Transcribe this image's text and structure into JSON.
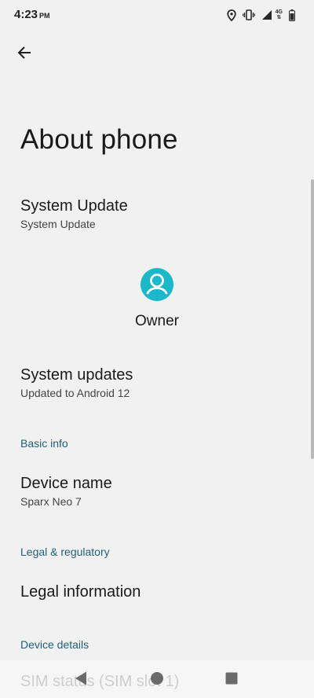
{
  "status_bar": {
    "time": "4:23",
    "ampm": "PM",
    "network_label": "4G"
  },
  "header": {
    "title": "About phone"
  },
  "items": {
    "system_update": {
      "title": "System Update",
      "subtitle": "System Update"
    },
    "owner": {
      "name": "Owner"
    },
    "system_updates": {
      "title": "System updates",
      "subtitle": "Updated to Android 12"
    },
    "basic_info_header": "Basic info",
    "device_name": {
      "title": "Device name",
      "subtitle": "Sparx Neo 7"
    },
    "legal_header": "Legal & regulatory",
    "legal_information": {
      "title": "Legal information"
    },
    "device_details_header": "Device details",
    "sim_status": {
      "title": "SIM status (SIM slot 1)"
    }
  },
  "colors": {
    "background": "#f1f1f1",
    "accent_teal": "#1ab8c8",
    "section_header": "#1f5f74"
  },
  "icons": {
    "back": "arrow-left-icon",
    "location": "location-pin-icon",
    "vibrate": "vibrate-icon",
    "signal": "signal-icon",
    "battery": "battery-icon",
    "avatar": "account-circle-icon",
    "nav_back": "triangle-back-icon",
    "nav_home": "circle-home-icon",
    "nav_recents": "square-recents-icon"
  }
}
